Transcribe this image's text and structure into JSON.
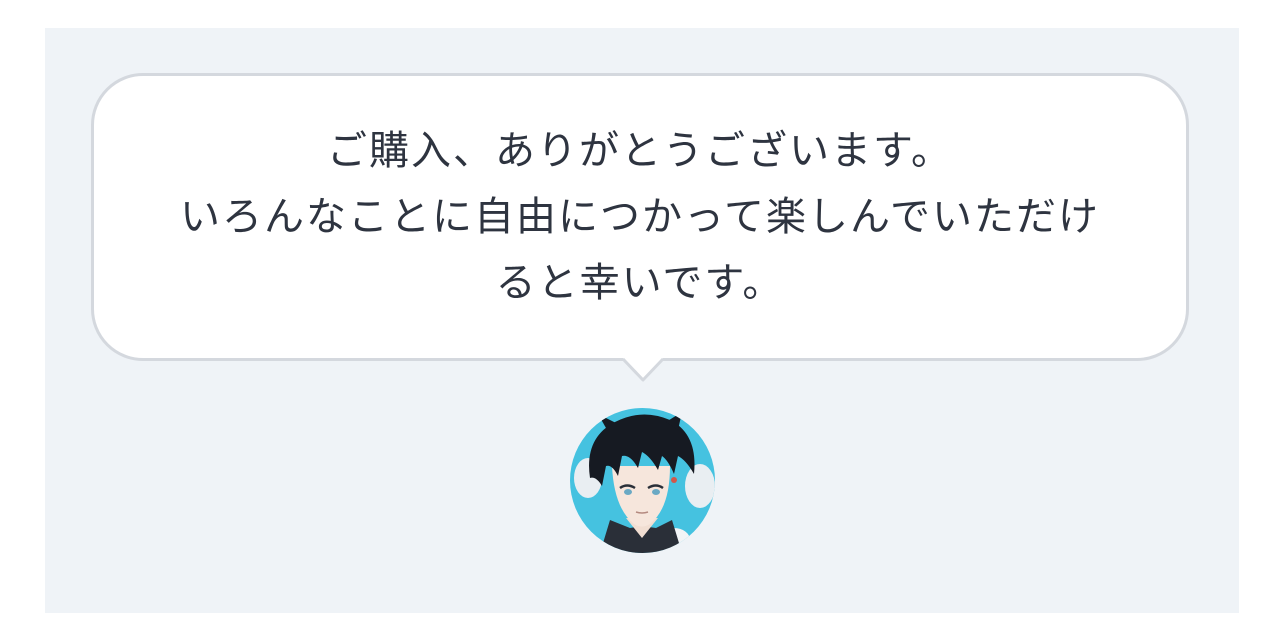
{
  "message": {
    "line1": "ご購入、ありがとうございます。",
    "line2": "いろんなことに自由につかって楽しんでいただけ",
    "line3": "ると幸いです。"
  },
  "avatar": {
    "icon": "illustrated-avatar-icon"
  },
  "colors": {
    "panel_bg": "#eff3f7",
    "bubble_bg": "#ffffff",
    "bubble_border": "#d4d8de",
    "text": "#2e3440",
    "avatar_bg": "#45c2e0"
  }
}
